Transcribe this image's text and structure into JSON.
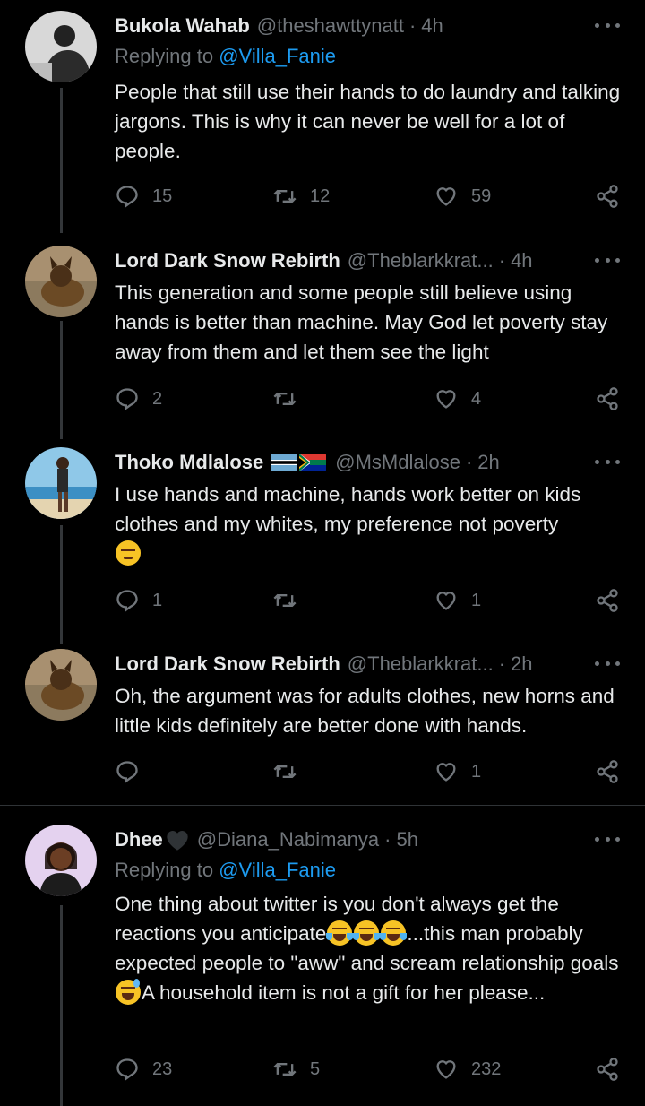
{
  "tweets": [
    {
      "name": "Bukola Wahab",
      "handle": "@theshawttynatt",
      "time": "4h",
      "replying_prefix": "Replying to",
      "replying_to": "@Villa_Fanie",
      "text": "People that still use their hands to do laundry and talking jargons. This is why it can never be well for a lot of people.",
      "replies": "15",
      "retweets": "12",
      "likes": "59"
    },
    {
      "name": "Lord Dark Snow Rebirth",
      "handle": "@Theblarkkrat...",
      "time": "4h",
      "text": "This generation and some people still believe using hands is better than machine. May God let poverty stay away from them and let them see the light",
      "replies": "2",
      "retweets": "",
      "likes": "4"
    },
    {
      "name": "Thoko Mdlalose",
      "handle": "@MsMdlalose",
      "time": "2h",
      "text": "I use hands and machine, hands work better on kids clothes and my whites, my preference not poverty",
      "replies": "1",
      "retweets": "",
      "likes": "1"
    },
    {
      "name": "Lord Dark Snow Rebirth",
      "handle": "@Theblarkkrat...",
      "time": "2h",
      "text": "Oh, the argument was for adults clothes, new horns and little kids definitely are better done with hands.",
      "replies": "",
      "retweets": "",
      "likes": "1"
    },
    {
      "name": "Dhee",
      "handle": "@Diana_Nabimanya",
      "time": "5h",
      "replying_prefix": "Replying to",
      "replying_to": "@Villa_Fanie",
      "text_part1": "One thing about twitter is you don't  always get the reactions you anticipate",
      "text_part2": "...this man probably expected  people to \"aww\" and scream relationship  goals",
      "text_part3": "A household item is not a gift for her please...",
      "replies": "23",
      "retweets": "5",
      "likes": "232"
    }
  ],
  "icons": {
    "reply": "reply-icon",
    "retweet": "retweet-icon",
    "like": "heart-icon",
    "share": "share-icon",
    "more": "more-icon"
  },
  "colors": {
    "background": "#000000",
    "text": "#e7e9ea",
    "muted": "#71767b",
    "link": "#1d9bf0"
  }
}
